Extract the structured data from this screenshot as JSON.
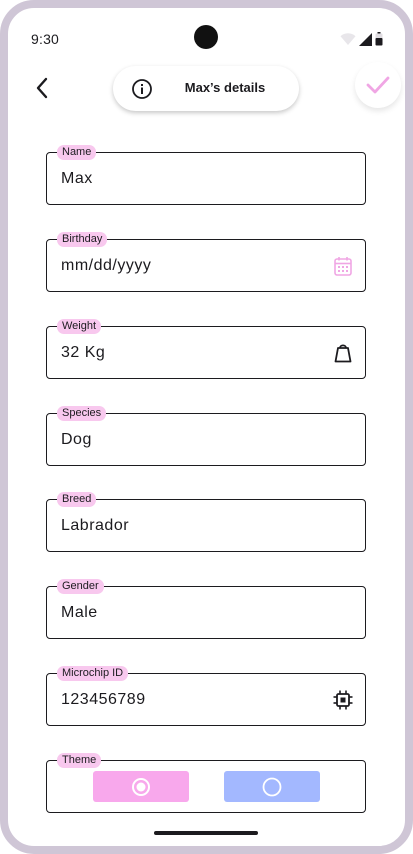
{
  "status_bar": {
    "time": "9:30",
    "icons": [
      "wifi-icon",
      "signal-icon",
      "battery-icon"
    ]
  },
  "app_bar": {
    "back_icon": "arrow-back-icon",
    "info_icon": "info-icon",
    "title": "Max’s details",
    "confirm_icon": "check-icon"
  },
  "form": {
    "name": {
      "label": "Name",
      "value": "Max"
    },
    "birthday": {
      "label": "Birthday",
      "placeholder": "mm/dd/yyyy",
      "icon": "calendar-icon"
    },
    "weight": {
      "label": "Weight",
      "value": "32 Kg",
      "icon": "weight-icon"
    },
    "species": {
      "label": "Species",
      "value": "Dog"
    },
    "breed": {
      "label": "Breed",
      "value": "Labrador"
    },
    "gender": {
      "label": "Gender",
      "value": "Male"
    },
    "microchip": {
      "label": "Microchip ID",
      "value": "123456789",
      "icon": "chip-icon"
    },
    "theme": {
      "label": "Theme",
      "options": [
        {
          "name": "pink",
          "color": "#f8a8ec",
          "selected": true
        },
        {
          "name": "blue",
          "color": "#a3b8ff",
          "selected": false
        }
      ]
    }
  },
  "colors": {
    "accent": "#f0a6e4",
    "label_chip": "#f8c8ee",
    "outline": "#1c1b1f"
  }
}
